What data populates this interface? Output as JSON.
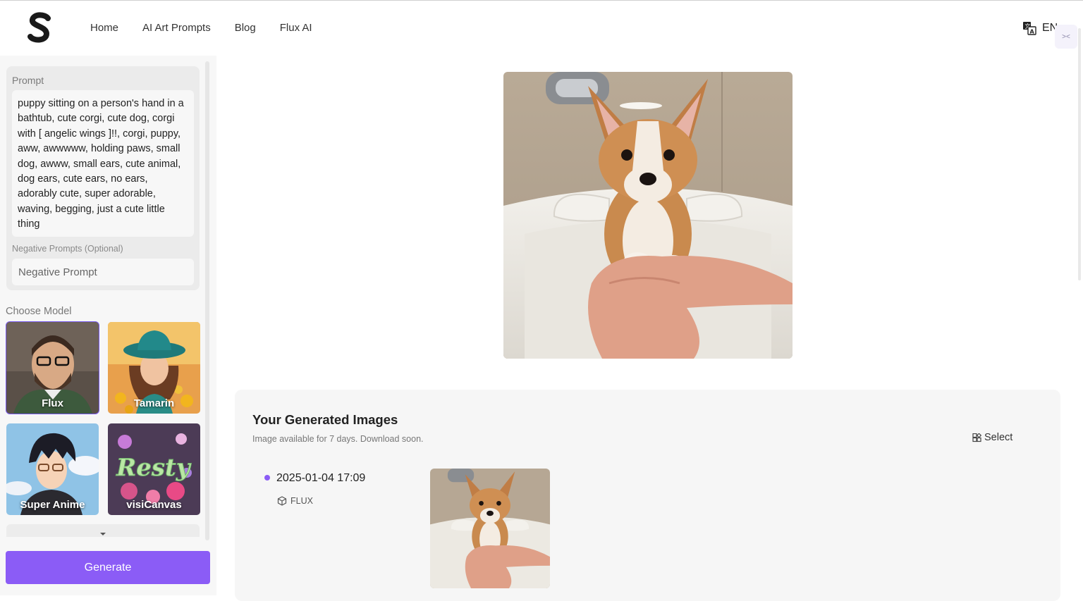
{
  "nav": {
    "links": [
      "Home",
      "AI Art Prompts",
      "Blog",
      "Flux AI"
    ],
    "language": "EN",
    "corner_widget": "><"
  },
  "sidebar": {
    "prompt_label": "Prompt",
    "prompt_text": "puppy sitting on a person's hand in a bathtub, cute corgi, cute dog, corgi with [ angelic wings ]!!, corgi, puppy, aww, awwwww, holding paws, small dog, awww, small ears, cute animal, dog ears, cute ears, no ears, adorably cute, super adorable, waving, begging, just a cute little thing",
    "negative_label": "Negative Prompts  (Optional)",
    "negative_placeholder": "Negative Prompt",
    "choose_model_label": "Choose Model",
    "models": [
      {
        "name": "Flux",
        "selected": true
      },
      {
        "name": "Tamarin",
        "selected": false
      },
      {
        "name": "Super Anime",
        "selected": false
      },
      {
        "name": "visiCanvas",
        "selected": false
      }
    ],
    "generate_label": "Generate"
  },
  "generated": {
    "title": "Your Generated Images",
    "subtitle": "Image available for 7 days. Download soon.",
    "select_label": "Select",
    "entries": [
      {
        "datetime": "2025-01-04 17:09",
        "model": "FLUX"
      }
    ]
  },
  "colors": {
    "accent": "#8b5cf6",
    "sidebar_bg": "#f7f7f7",
    "panel_bg": "#f6f6f6"
  },
  "icons": {
    "logo": "s-logo",
    "language": "translate-icon",
    "select": "grid-select-icon",
    "model_tag": "cube-icon",
    "expand": "caret-down-icon"
  }
}
